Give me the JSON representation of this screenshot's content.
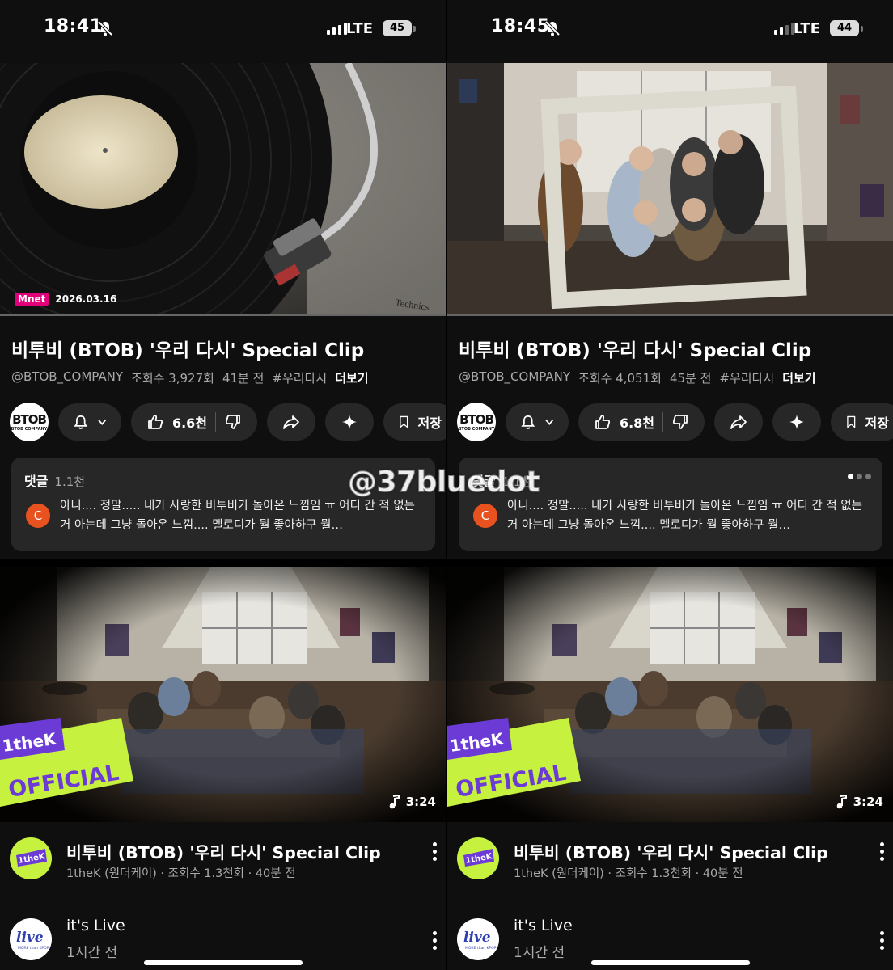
{
  "panels": [
    {
      "status": {
        "time": "18:41",
        "network": "LTE",
        "battery": "45"
      },
      "player": {
        "broadcaster": "net",
        "broadcaster_m": "M",
        "date": "2026.03.16",
        "brand": "Technics"
      },
      "video": {
        "title": "비투비 (BTOB) '우리 다시' Special Clip",
        "channel": "@BTOB_COMPANY",
        "views": "조회수 3,927회",
        "age": "41분 전",
        "hashtag": "#우리다시",
        "more": "더보기"
      },
      "channel_logo": {
        "mark": "BTOB",
        "sub": "BTOB COMPANY"
      },
      "actions": {
        "likes": "6.6천",
        "save": "저장"
      },
      "comments": {
        "label": "댓글",
        "count": "1.1천",
        "avatar": "C",
        "text": "아니.... 정말..... 내가 사랑한 비투비가 돌아온 느낌임 ㅠ 어디 간 적 없는 거 아는데 그냥 돌아온 느낌.... 멜로디가 뭘 좋아하구 뭘…"
      },
      "next": {
        "badge_line1": "1theK",
        "badge_line2": "OFFICIAL",
        "duration": "3:24",
        "title": "비투비 (BTOB) '우리 다시' Special Clip",
        "meta": "1theK (원더케이) · 조회수 1.3천회 · 40분 전",
        "logo_text": "1theK"
      },
      "live": {
        "name": "it's Live",
        "age": "1시간 전",
        "logo_text": "live",
        "logo_sub": "MORE than KPOP"
      }
    },
    {
      "status": {
        "time": "18:45",
        "network": "LTE",
        "battery": "44"
      },
      "video": {
        "title": "비투비 (BTOB) '우리 다시' Special Clip",
        "channel": "@BTOB_COMPANY",
        "views": "조회수 4,051회",
        "age": "45분 전",
        "hashtag": "#우리다시",
        "more": "더보기"
      },
      "channel_logo": {
        "mark": "BTOB",
        "sub": "BTOB COMPANY"
      },
      "actions": {
        "likes": "6.8천",
        "save": "저장"
      },
      "comments": {
        "label": "댓글",
        "count": "1.1천",
        "avatar": "C",
        "text": "아니.... 정말..... 내가 사랑한 비투비가 돌아온 느낌임 ㅠ 어디 간 적 없는 거 아는데 그냥 돌아온 느낌.... 멜로디가 뭘 좋아하구 뭘…"
      },
      "next": {
        "badge_line1": "1theK",
        "badge_line2": "OFFICIAL",
        "duration": "3:24",
        "title": "비투비 (BTOB) '우리 다시' Special Clip",
        "meta": "1theK (원더케이) · 조회수 1.3천회 · 40분 전",
        "logo_text": "1theK"
      },
      "live": {
        "name": "it's Live",
        "age": "1시간 전",
        "logo_text": "live",
        "logo_sub": "MORE than KPOP"
      }
    }
  ],
  "watermark": "@37bluedot",
  "colors": {
    "background": "#0f0f0f",
    "pill": "#272727",
    "badge_green": "#c6f13f",
    "badge_purple": "#6c3bd6",
    "avatar_orange": "#e8521f",
    "mnet_pink": "#e2007a"
  }
}
